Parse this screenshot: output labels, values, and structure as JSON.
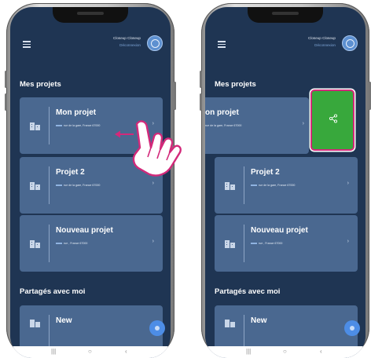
{
  "user": {
    "name": "Closeup Closeup",
    "logout": "Déconnexion"
  },
  "my_projects_title": "Mes projets",
  "shared_title": "Partagés avec moi",
  "left_projects": [
    {
      "title": "Mon projet",
      "address": "rue de la gare, France 67000"
    },
    {
      "title": "Projet 2",
      "address": "rue de la gare, France 67000"
    },
    {
      "title": "Nouveau projet",
      "address": "rue , France 67000"
    }
  ],
  "right_first_title_partial": "on projet",
  "right_first_address_partial": "rue de la gare, France 67000",
  "shared_projects": [
    {
      "title": "New"
    }
  ],
  "icons": {
    "menu": "hamburger-icon",
    "avatar": "user-avatar-icon",
    "building": "building-icon",
    "chevron": "chevron-right-icon",
    "share": "share-icon",
    "fab": "add-icon",
    "swipe": "arrow-left-icon",
    "hand": "pointing-hand-icon"
  },
  "colors": {
    "share_green": "#38a83c",
    "highlight_pink": "#d3297a",
    "screen_bg": "#1f3553",
    "card_bg": "#4a6890"
  }
}
